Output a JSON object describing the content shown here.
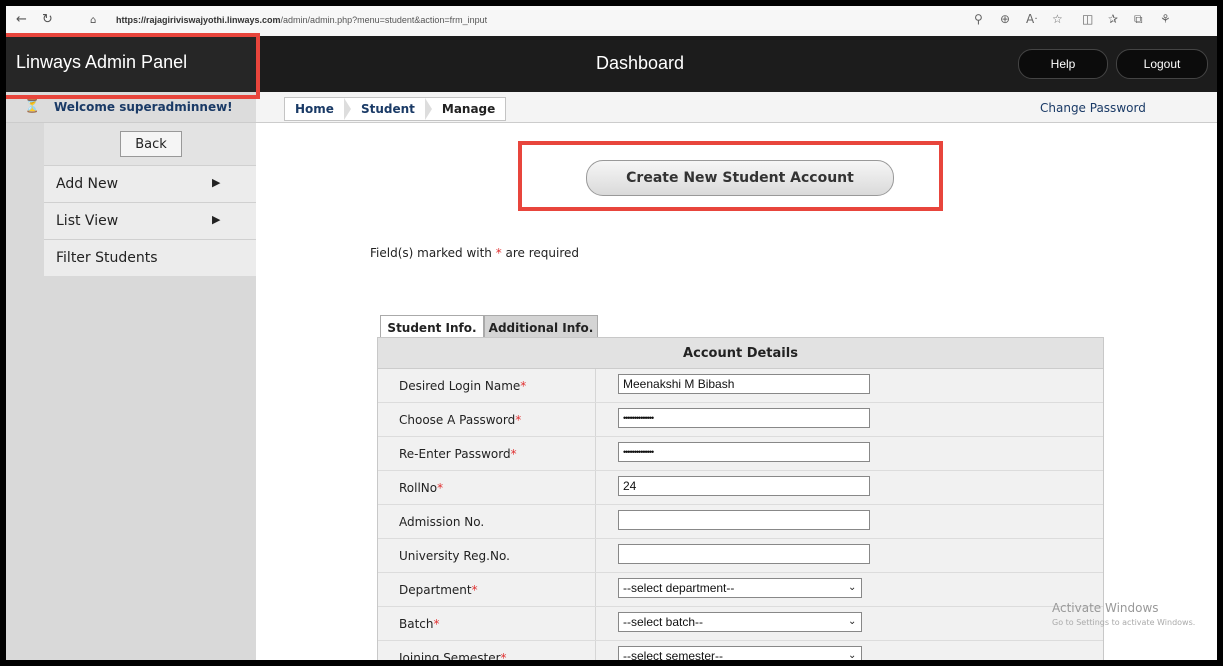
{
  "browser": {
    "url_host": "https://rajagiriviswajyothi.linways.com",
    "url_path": "/admin/admin.php?menu=student&action=frm_input"
  },
  "header": {
    "brand": "Linways Admin Panel",
    "title": "Dashboard",
    "help_label": "Help",
    "logout_label": "Logout"
  },
  "subbar": {
    "welcome": "Welcome superadminnew!",
    "breadcrumb": [
      "Home",
      "Student",
      "Manage"
    ],
    "change_password": "Change Password"
  },
  "sidebar": {
    "back_label": "Back",
    "items": [
      {
        "label": "Add New",
        "arrow": "▶"
      },
      {
        "label": "List View",
        "arrow": "▶"
      },
      {
        "label": "Filter Students",
        "arrow": ""
      }
    ]
  },
  "main": {
    "create_button": "Create New Student Account",
    "required_note_prefix": "Field(s) marked with ",
    "required_note_star": "*",
    "required_note_suffix": " are required",
    "tabs": [
      "Student Info.",
      "Additional Info."
    ],
    "section_title": "Account Details",
    "fields": [
      {
        "label": "Desired Login Name",
        "required": "*",
        "type": "text",
        "value": "Meenakshi M Bibash"
      },
      {
        "label": "Choose A Password",
        "required": "*",
        "type": "password",
        "value": "••••••••••••••"
      },
      {
        "label": "Re-Enter Password",
        "required": "*",
        "type": "password",
        "value": "••••••••••••••"
      },
      {
        "label": "RollNo",
        "required": "*",
        "type": "text",
        "value": "24"
      },
      {
        "label": "Admission No.",
        "required": "",
        "type": "text",
        "value": ""
      },
      {
        "label": "University Reg.No.",
        "required": "",
        "type": "text",
        "value": ""
      },
      {
        "label": "Department",
        "required": "*",
        "type": "select",
        "value": "--select department--"
      },
      {
        "label": "Batch",
        "required": "*",
        "type": "select",
        "value": "--select batch--"
      },
      {
        "label": "Joining Semester",
        "required": "*",
        "type": "select",
        "value": "--select semester--"
      }
    ]
  },
  "watermark": {
    "line1": "Activate Windows",
    "line2": "Go to Settings to activate Windows."
  },
  "colors": {
    "highlight": "#e8453c",
    "header_bg": "#1c1c1c",
    "link": "#1a3a66",
    "required_star": "#e03030"
  }
}
